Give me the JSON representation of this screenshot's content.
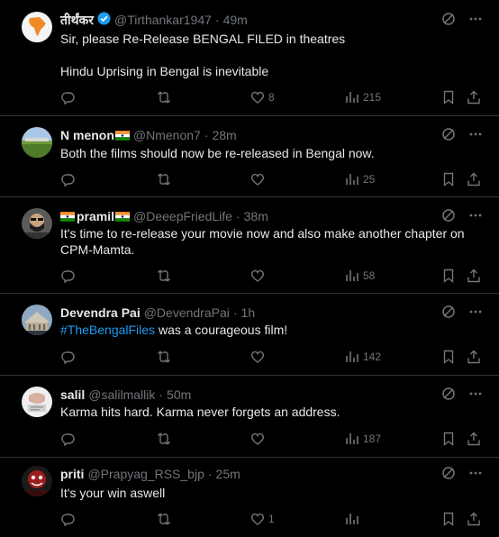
{
  "tweets": [
    {
      "name": "तीर्थंकर",
      "verified": true,
      "flag": false,
      "handle": "@Tirthankar1947",
      "time": "49m",
      "lines": [
        "Sir, please Re-Release BENGAL FILED in theatres",
        "",
        "Hindu Uprising in Bengal is inevitable"
      ],
      "likes": "8",
      "views": "215"
    },
    {
      "name": "N menon",
      "verified": false,
      "flag": true,
      "handle": "@Nmenon7",
      "time": "28m",
      "lines": [
        "Both the films should now be re-released in Bengal now."
      ],
      "likes": "",
      "views": "25"
    },
    {
      "name": "pramil",
      "verified": false,
      "flag": true,
      "flag_before_name": true,
      "handle": "@DeeepFriedLife",
      "time": "38m",
      "lines": [
        "It's time to re-release your movie now and also make another chapter on",
        "CPM-Mamta."
      ],
      "likes": "",
      "views": "58"
    },
    {
      "name": "Devendra Pai",
      "verified": false,
      "flag": false,
      "handle": "@DevendraPai",
      "time": "1h",
      "hashtag": "#TheBengalFiles",
      "lines": [
        " was a courageous film!"
      ],
      "likes": "",
      "views": "142"
    },
    {
      "name": "salil",
      "verified": false,
      "flag": false,
      "handle": "@salilmallik",
      "time": "50m",
      "lines": [
        "Karma hits hard. Karma never forgets an address."
      ],
      "likes": "",
      "views": "187"
    },
    {
      "name": "priti",
      "verified": false,
      "flag": false,
      "handle": "@Prapyag_RSS_bjp",
      "time": "25m",
      "lines": [
        "It's your win aswell"
      ],
      "likes": "1",
      "views": ""
    }
  ],
  "icons": {
    "reply": "reply-icon",
    "retweet": "retweet-icon",
    "like": "heart-icon",
    "views": "views-icon",
    "bookmark": "bookmark-icon",
    "share": "share-icon",
    "grok": "grok-icon",
    "more": "more-icon"
  },
  "colors": {
    "background": "#000000",
    "text": "#e7e9ea",
    "muted": "#71767b",
    "link": "#1d9bf0",
    "divider": "#2f3336"
  }
}
